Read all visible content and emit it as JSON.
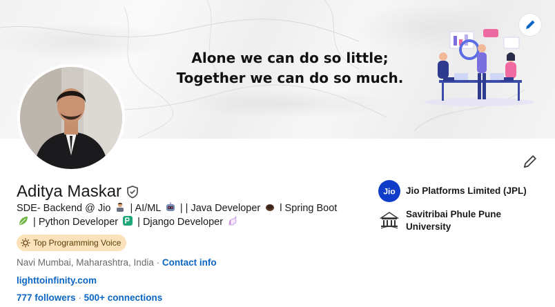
{
  "banner": {
    "quote_line1": "Alone we can do so little;",
    "quote_line2": "Together we can do so much."
  },
  "profile": {
    "name": "Aditya Maskar",
    "headline_parts": {
      "p1": "SDE- Backend @ Jio",
      "p2": "| AI/ML",
      "p3": "| | Java Developer",
      "p4": "l Spring Boot",
      "p5": "| Python Developer",
      "p6": "| Django Developer"
    },
    "badge": "Top Programming Voice",
    "location": "Navi Mumbai, Maharashtra, India",
    "dot": "·",
    "contact_info": "Contact info",
    "website": "lighttoinfinity.com",
    "followers": "777 followers",
    "connections": "500+ connections"
  },
  "experience": [
    {
      "name": "Jio Platforms Limited (JPL)",
      "logo_text": "Jio"
    },
    {
      "name": "Savitribai Phule Pune University"
    }
  ],
  "icons": {
    "banner_edit": "pencil-icon",
    "profile_edit": "pencil-icon",
    "verified": "shield-check-icon",
    "badge": "sun-icon"
  },
  "colors": {
    "link": "#0a66c2",
    "badge_bg": "#fce2ba",
    "jio_blue": "#0f3cc9"
  }
}
